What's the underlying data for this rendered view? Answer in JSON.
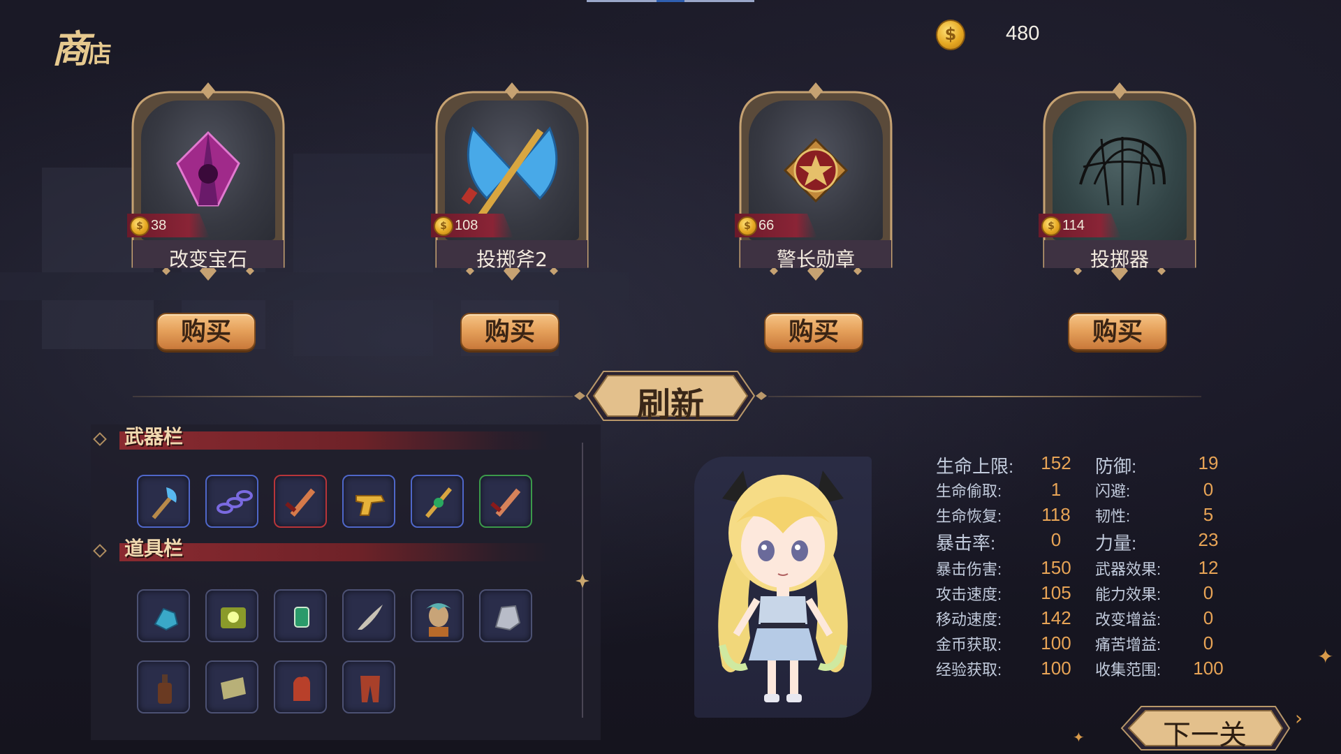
{
  "shop": {
    "title_big": "商",
    "title_small": "店"
  },
  "currency": {
    "amount": "480",
    "coin_glyph": "$"
  },
  "shop_items": [
    {
      "name": "改变宝石",
      "price": "38",
      "icon": "purple-gem-icon"
    },
    {
      "name": "投掷斧2",
      "price": "108",
      "icon": "battle-axe-icon"
    },
    {
      "name": "警长勋章",
      "price": "66",
      "icon": "sheriff-badge-icon"
    },
    {
      "name": "投掷器",
      "price": "114",
      "icon": "net-launcher-icon"
    }
  ],
  "buy_label": "购买",
  "refresh_label": "刷新",
  "inventory": {
    "weapons_title": "武器栏",
    "items_title": "道具栏",
    "weapons": [
      {
        "icon": "ice-axe-icon",
        "rarity": "blue"
      },
      {
        "icon": "chain-icon",
        "rarity": "blue"
      },
      {
        "icon": "red-sword-icon",
        "rarity": "red"
      },
      {
        "icon": "golden-revolver-icon",
        "rarity": "blue"
      },
      {
        "icon": "emerald-scepter-icon",
        "rarity": "blue"
      },
      {
        "icon": "short-sword-icon",
        "rarity": "green"
      }
    ],
    "items": [
      {
        "icon": "blue-crystal-icon"
      },
      {
        "icon": "glowing-scroll-icon"
      },
      {
        "icon": "emerald-gem-icon"
      },
      {
        "icon": "feather-icon"
      },
      {
        "icon": "elf-portrait-icon"
      },
      {
        "icon": "silver-rock-icon"
      },
      {
        "icon": "bottle-icon"
      },
      {
        "icon": "map-scroll-icon"
      },
      {
        "icon": "red-glove-icon"
      },
      {
        "icon": "red-pants-icon"
      }
    ]
  },
  "stats": [
    {
      "label": "生命上限:",
      "value": "152",
      "label2": "防御:",
      "value2": "19",
      "big": true
    },
    {
      "label": "生命偷取:",
      "value": "1",
      "label2": "闪避:",
      "value2": "0",
      "big": false
    },
    {
      "label": "生命恢复:",
      "value": "118",
      "label2": "韧性:",
      "value2": "5",
      "big": false
    },
    {
      "label": "暴击率:",
      "value": "0",
      "label2": "力量:",
      "value2": "23",
      "big": true
    },
    {
      "label": "暴击伤害:",
      "value": "150",
      "label2": "武器效果:",
      "value2": "12",
      "big": false
    },
    {
      "label": "攻击速度:",
      "value": "105",
      "label2": "能力效果:",
      "value2": "0",
      "big": false
    },
    {
      "label": "移动速度:",
      "value": "142",
      "label2": "改变增益:",
      "value2": "0",
      "big": false
    },
    {
      "label": "金币获取:",
      "value": "100",
      "label2": "痛苦增益:",
      "value2": "0",
      "big": false
    },
    {
      "label": "经验获取:",
      "value": "100",
      "label2": "收集范围:",
      "value2": "100",
      "big": false
    }
  ],
  "next_label": "下一关",
  "colors": {
    "accent_gold": "#e6a25c",
    "stat_value": "#e8a456",
    "panel": "#201f2c"
  }
}
